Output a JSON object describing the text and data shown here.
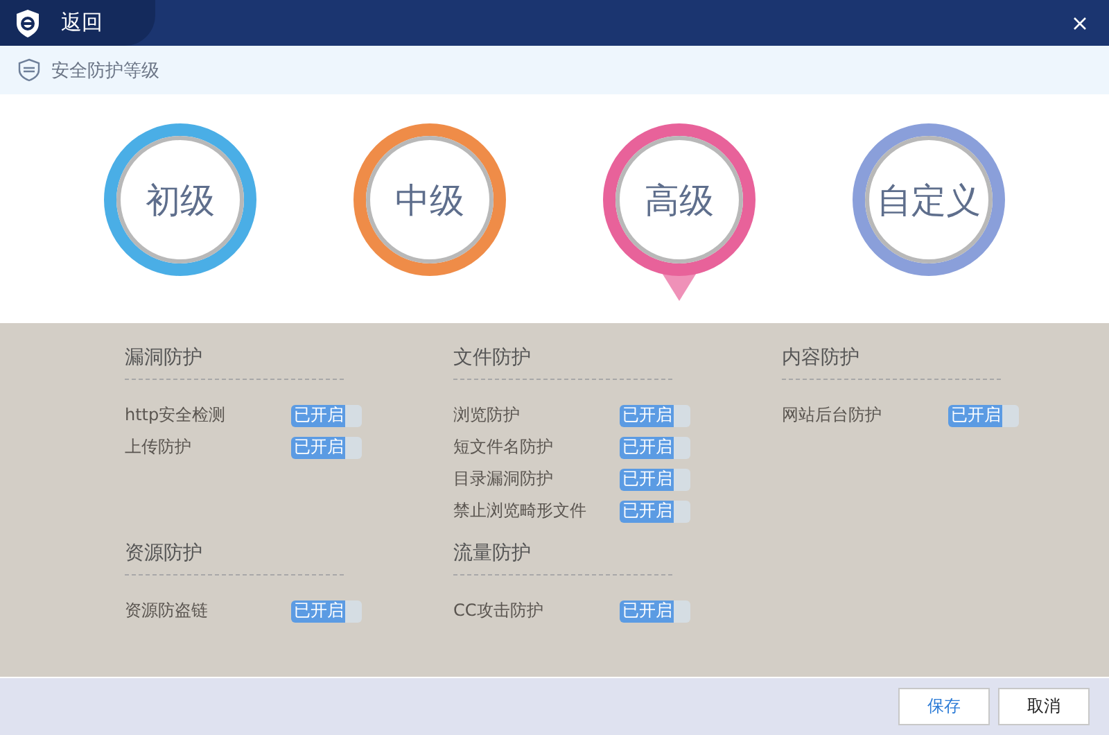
{
  "header": {
    "back_label": "返回"
  },
  "subheader": {
    "title": "安全防护等级"
  },
  "levels": [
    {
      "label": "初级",
      "color": "#4aaee6",
      "selected": false
    },
    {
      "label": "中级",
      "color": "#ef8c48",
      "selected": false
    },
    {
      "label": "高级",
      "color": "#e8629a",
      "selected": true
    },
    {
      "label": "自定义",
      "color": "#8a9fda",
      "selected": false
    }
  ],
  "sections": [
    {
      "title": "漏洞防护",
      "items": [
        {
          "label": "http安全检测",
          "status": "已开启",
          "on": true
        },
        {
          "label": "上传防护",
          "status": "已开启",
          "on": true
        }
      ]
    },
    {
      "title": "文件防护",
      "items": [
        {
          "label": "浏览防护",
          "status": "已开启",
          "on": true
        },
        {
          "label": "短文件名防护",
          "status": "已开启",
          "on": true
        },
        {
          "label": "目录漏洞防护",
          "status": "已开启",
          "on": true
        },
        {
          "label": "禁止浏览畸形文件",
          "status": "已开启",
          "on": true
        }
      ]
    },
    {
      "title": "内容防护",
      "items": [
        {
          "label": "网站后台防护",
          "status": "已开启",
          "on": true
        }
      ]
    },
    {
      "title": "资源防护",
      "items": [
        {
          "label": "资源防盗链",
          "status": "已开启",
          "on": true
        }
      ]
    },
    {
      "title": "流量防护",
      "items": [
        {
          "label": "CC攻击防护",
          "status": "已开启",
          "on": true
        }
      ]
    }
  ],
  "buttons": [
    {
      "label": "保存",
      "kind": "primary"
    },
    {
      "label": "取消",
      "kind": "secondary"
    }
  ]
}
